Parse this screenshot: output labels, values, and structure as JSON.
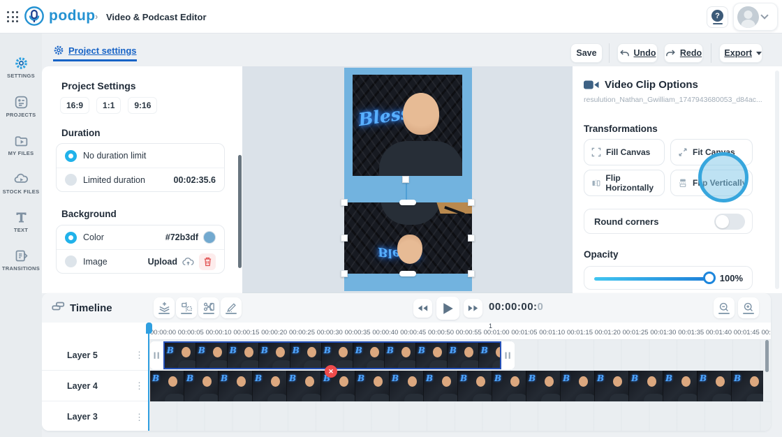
{
  "app": {
    "logo": "podup",
    "breadcrumb_separator": "›",
    "title": "Video & Podcast Editor"
  },
  "topbar": {
    "help_label": "?"
  },
  "toolbar": {
    "active_tab": "Project settings",
    "save": "Save",
    "undo": "Undo",
    "redo": "Redo",
    "export": "Export"
  },
  "sidebar": {
    "items": [
      {
        "label": "SETTINGS",
        "icon": "gear-icon",
        "active": true
      },
      {
        "label": "PROJECTS",
        "icon": "projects-icon",
        "active": false
      },
      {
        "label": "MY FILES",
        "icon": "folder-play-icon",
        "active": false
      },
      {
        "label": "STOCK FILES",
        "icon": "cloud-play-icon",
        "active": false
      },
      {
        "label": "TEXT",
        "icon": "text-icon",
        "active": false
      },
      {
        "label": "TRANSITIONS",
        "icon": "transitions-icon",
        "active": false
      }
    ]
  },
  "project_settings": {
    "title": "Project Settings",
    "aspect_ratios": [
      "16:9",
      "1:1",
      "9:16"
    ],
    "duration": {
      "heading": "Duration",
      "option_no_limit": "No duration limit",
      "option_limited": "Limited duration",
      "limited_value": "00:02:35.6",
      "selected": "No duration limit"
    },
    "background": {
      "heading": "Background",
      "option_color": "Color",
      "color_value": "#72b3df",
      "option_image": "Image",
      "upload_label": "Upload",
      "selected": "Color"
    }
  },
  "canvas": {
    "background_color": "#72b3df",
    "neon_text": "Blesse",
    "neon_text_short": "B"
  },
  "clip_options": {
    "title": "Video Clip Options",
    "filename": "resulution_Nathan_Gwilliam_1747943680053_d84ac...",
    "transformations_heading": "Transformations",
    "buttons": [
      {
        "label": "Fill Canvas",
        "icon": "fill-canvas-icon",
        "highlighted": false
      },
      {
        "label": "Fit Canvas",
        "icon": "fit-canvas-icon",
        "highlighted": false
      },
      {
        "label": "Flip Horizontally",
        "icon": "flip-horizontal-icon",
        "highlighted": false
      },
      {
        "label": "Flip Vertically",
        "icon": "flip-vertical-icon",
        "highlighted": true
      }
    ],
    "round_corners_label": "Round corners",
    "round_corners_on": false,
    "opacity_label": "Opacity",
    "opacity_value": "100%"
  },
  "timeline": {
    "title": "Timeline",
    "tool_icons": [
      "add-layer-icon",
      "split-clip-icon",
      "cut-clip-icon",
      "draw-icon"
    ],
    "timecode_main": "00:00:00:",
    "timecode_frame": "0",
    "minute_marker": "1",
    "ruler": [
      "00:00:00",
      "00:00:05",
      "00:00:10",
      "00:00:15",
      "00:00:20",
      "00:00:25",
      "00:00:30",
      "00:00:35",
      "00:00:40",
      "00:00:45",
      "00:00:50",
      "00:00:55",
      "00:01:00",
      "00:01:05",
      "00:01:10",
      "00:01:15",
      "00:01:20",
      "00:01:25",
      "00:01:30",
      "00:01:35",
      "00:01:40",
      "00:01:45",
      "00:0"
    ],
    "layers": [
      {
        "name": "Layer 5"
      },
      {
        "name": "Layer 4"
      },
      {
        "name": "Layer 3"
      }
    ]
  },
  "colors": {
    "accent": "#2b9fe0",
    "canvas_blue": "#72b3df",
    "link_blue": "#1763c6",
    "danger": "#ef4b4b"
  }
}
